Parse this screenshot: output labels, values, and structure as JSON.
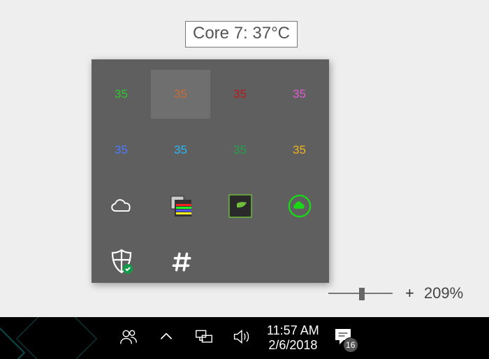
{
  "tooltip": {
    "text": "Core 7: 37°C"
  },
  "overflow": {
    "cores": [
      {
        "value": "35"
      },
      {
        "value": "35"
      },
      {
        "value": "35"
      },
      {
        "value": "35"
      },
      {
        "value": "35"
      },
      {
        "value": "35"
      },
      {
        "value": "35"
      },
      {
        "value": "35"
      }
    ],
    "apps": [
      {
        "name": "onedrive"
      },
      {
        "name": "rgb-utility"
      },
      {
        "name": "nvidia"
      },
      {
        "name": "razer"
      },
      {
        "name": "windows-defender"
      },
      {
        "name": "channel"
      }
    ]
  },
  "zoom": {
    "plus": "+",
    "percent": "209%"
  },
  "taskbar": {
    "time": "11:57 AM",
    "date": "2/6/2018",
    "action_center_count": "16"
  }
}
